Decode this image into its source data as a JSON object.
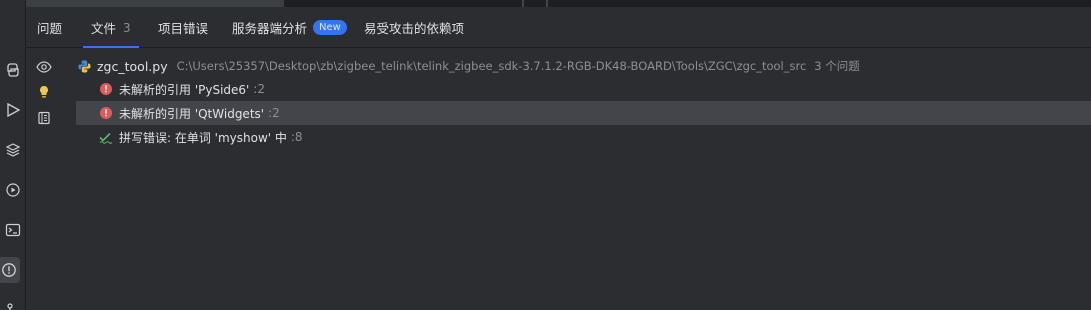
{
  "tabs": [
    {
      "label": "问题",
      "count": "",
      "badge": ""
    },
    {
      "label": "文件",
      "count": "3",
      "badge": ""
    },
    {
      "label": "项目错误",
      "count": "",
      "badge": ""
    },
    {
      "label": "服务器端分析",
      "count": "",
      "badge": "New"
    },
    {
      "label": "易受攻击的依赖项",
      "count": "",
      "badge": ""
    }
  ],
  "selected_tab": "文件",
  "file": {
    "name": "zgc_tool.py",
    "path": "C:\\Users\\25357\\Desktop\\zb\\zigbee_telink\\telink_zigbee_sdk-3.7.1.2-RGB-DK48-BOARD\\Tools\\ZGC\\zgc_tool_src",
    "problem_count": "3 个问题"
  },
  "problems": [
    {
      "kind": "error",
      "message": "未解析的引用 'PySide6'",
      "line": ":2",
      "highlighted": false
    },
    {
      "kind": "error",
      "message": "未解析的引用 'QtWidgets'",
      "line": ":2",
      "highlighted": true
    },
    {
      "kind": "typo",
      "message": "拼写错误: 在单词 'myshow' 中",
      "line": ":8",
      "highlighted": false
    }
  ],
  "side_tools": [
    "eye-icon",
    "lightbulb-icon",
    "preview-icon"
  ],
  "left_strip": [
    "python-icon",
    "run-icon",
    "layers-icon",
    "services-icon",
    "terminal-icon",
    "problems-icon",
    "git-icon"
  ],
  "colors": {
    "accent": "#3574f0",
    "error": "#db5c5c",
    "typo": "#5fb865",
    "bulb": "#f2c55c",
    "python_blue": "#4a88c7",
    "python_yellow": "#e5c158"
  }
}
